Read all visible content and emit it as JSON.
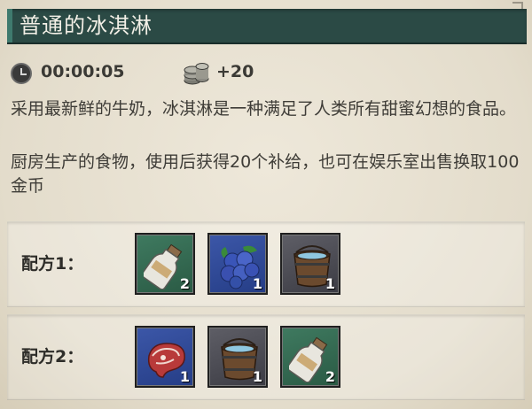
{
  "title": "普通的冰淇淋",
  "stats": {
    "time": "00:00:05",
    "coins": "+20"
  },
  "description": {
    "line1": "采用最新鲜的牛奶，冰淇淋是一种满足了人类所有甜蜜幻想的食品。",
    "line2": "厨房生产的食物，使用后获得20个补给，也可在娱乐室出售换取100金币"
  },
  "recipes": [
    {
      "label": "配方1：",
      "ingredients": [
        {
          "icon": "milk-bottle-icon",
          "count": "2",
          "rarity": "green"
        },
        {
          "icon": "blueberry-icon",
          "count": "1",
          "rarity": "blue"
        },
        {
          "icon": "water-bucket-icon",
          "count": "1",
          "rarity": "gray"
        }
      ]
    },
    {
      "label": "配方2：",
      "ingredients": [
        {
          "icon": "steak-icon",
          "count": "1",
          "rarity": "blue"
        },
        {
          "icon": "water-bucket-icon",
          "count": "1",
          "rarity": "gray"
        },
        {
          "icon": "milk-bottle-icon",
          "count": "2",
          "rarity": "green"
        }
      ]
    }
  ],
  "colors": {
    "title_bar": "#2b4a45",
    "background": "#e6dfd0",
    "rarity_green": "#3f7a60",
    "rarity_blue": "#3c57a8",
    "rarity_gray": "#5e5e66"
  }
}
